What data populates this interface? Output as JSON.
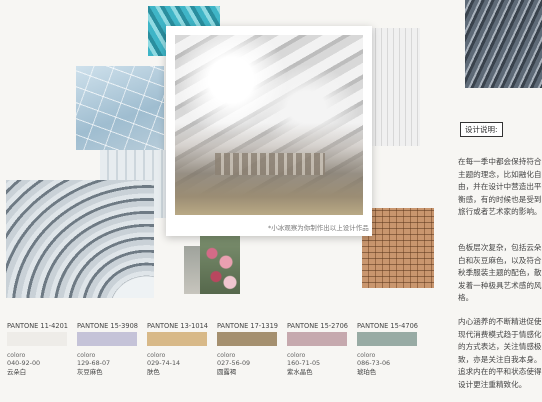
{
  "caption": "*小冰观察为你制作出以上设计作品",
  "design_label": "设计说明:",
  "paragraphs": [
    "在每一季中都会保持符合主题的理念，比如融化自由，并在设计中营造出平衡感，有的时候也是受到旅行或者艺术家的影响。",
    "色板层次复杂，包括云朵白和灰豆麻色，以及符合秋季服装主题的配色，散发着一种极具艺术感的风格。",
    "内心涵养的不断精进促使现代消费模式趋于情感化的方式表达，关注情感极致，亦是关注自我本身。追求内在的平和状态使得设计更注重精致化。"
  ],
  "swatches": [
    {
      "name": "PANTONE 11-4201",
      "brand": "coloro",
      "code": "040-92-00",
      "cn": "云朵白",
      "color": "#eeece8"
    },
    {
      "name": "PANTONE 15-3908",
      "brand": "coloro",
      "code": "129-68-07",
      "cn": "灰豆麻色",
      "color": "#c5c3d8"
    },
    {
      "name": "PANTONE 13-1014",
      "brand": "coloro",
      "code": "029-74-14",
      "cn": "肤色",
      "color": "#d8b988"
    },
    {
      "name": "PANTONE 17-1319",
      "brand": "coloro",
      "code": "027-56-09",
      "cn": "圆露褐",
      "color": "#a5906f"
    },
    {
      "name": "PANTONE 15-2706",
      "brand": "coloro",
      "code": "160-71-05",
      "cn": "紫水晶色",
      "color": "#c6a9ae"
    },
    {
      "name": "PANTONE 15-4706",
      "brand": "coloro",
      "code": "086-73-06",
      "cn": "琥珀色",
      "color": "#98aba4"
    }
  ]
}
